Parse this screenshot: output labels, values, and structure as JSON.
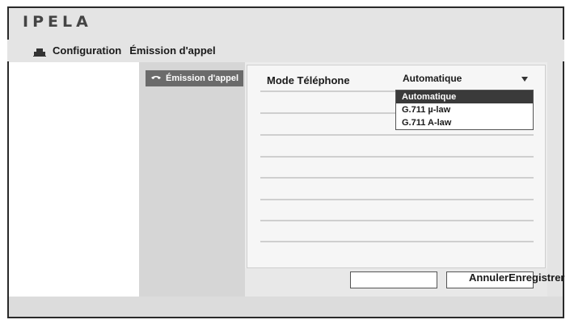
{
  "brand": {
    "logo_text": "IPELA"
  },
  "header": {
    "icon": "camera-config-icon",
    "title": "Configuration",
    "section": "Émission d'appel"
  },
  "sidebar": {
    "items": [
      {
        "label": "Émission d'appel",
        "icon": "phone-icon",
        "active": true
      }
    ]
  },
  "form": {
    "fields": [
      {
        "label": "Mode Téléphone",
        "value": "Automatique",
        "options": [
          "Automatique",
          "G.711 µ-law",
          "G.711 A-law"
        ],
        "selected_index": 0
      }
    ]
  },
  "footer": {
    "cancel_label": "Annuler",
    "save_label": "Enregistrer"
  },
  "colors": {
    "frame_border": "#2a2a2a",
    "nav_active": "#6b6b6b",
    "selected_option": "#3a3a3a"
  }
}
